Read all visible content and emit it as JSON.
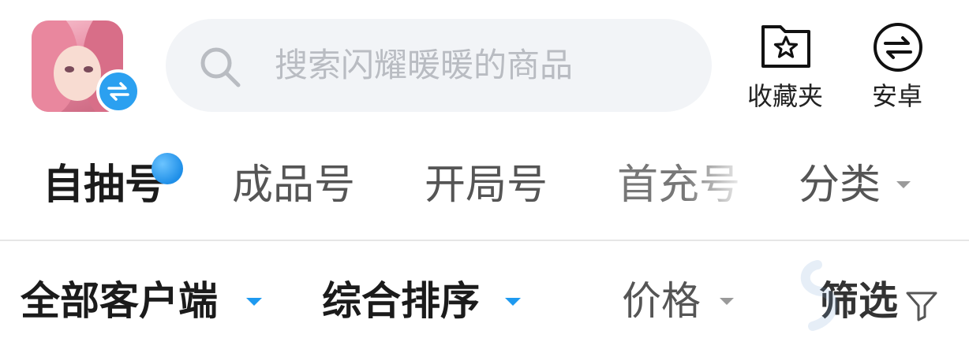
{
  "search": {
    "placeholder": "搜索闪耀暖暖的商品"
  },
  "actions": [
    {
      "label": "收藏夹",
      "icon": "star-folder-icon"
    },
    {
      "label": "安卓",
      "icon": "swap-circle-icon"
    }
  ],
  "category_tabs": [
    {
      "label": "自抽号",
      "active": true,
      "badge": "dot"
    },
    {
      "label": "成品号",
      "active": false
    },
    {
      "label": "开局号",
      "active": false
    },
    {
      "label": "首充号",
      "active": false
    },
    {
      "label": "分类",
      "active": false,
      "dropdown": true
    }
  ],
  "filters": [
    {
      "label": "全部客户端",
      "dropdown": true,
      "accent": "#1e9af0"
    },
    {
      "label": "综合排序",
      "dropdown": true,
      "accent": "#1e9af0"
    },
    {
      "label": "价格",
      "dropdown": true
    },
    {
      "label": "筛选",
      "icon": "filter-icon"
    }
  ],
  "colors": {
    "accent": "#1e9af0",
    "badge": "#2ba0f0",
    "search_bg": "#f2f4f7"
  }
}
